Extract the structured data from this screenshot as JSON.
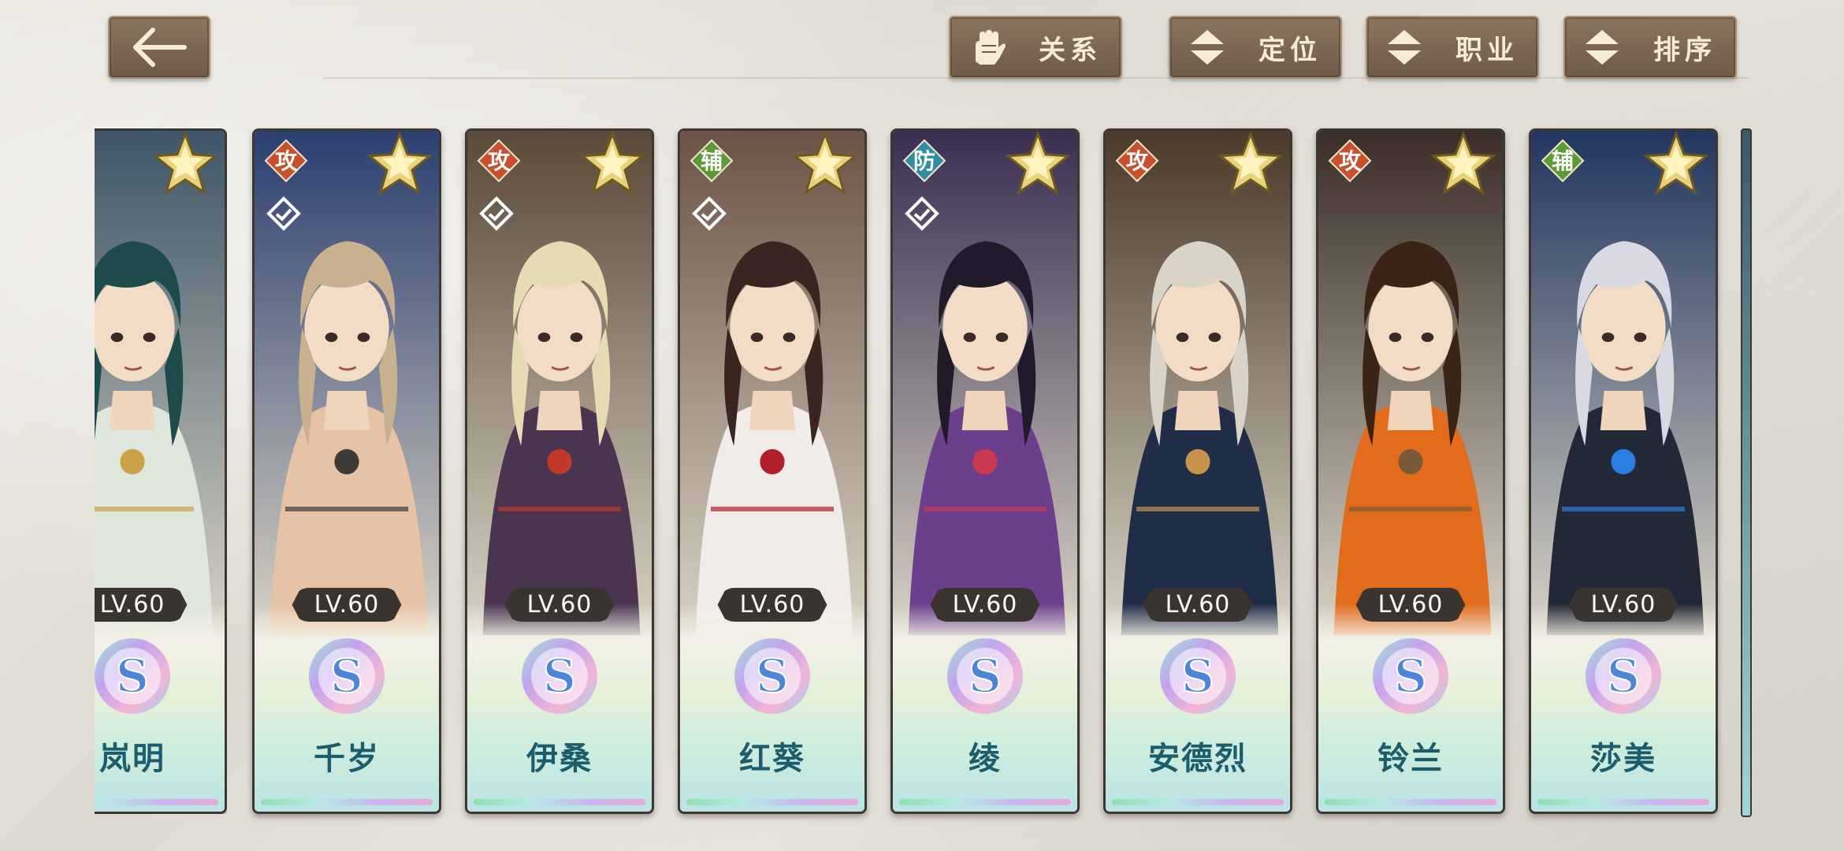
{
  "header": {
    "back_icon": "back-arrow-icon",
    "filters": [
      {
        "label": "关系",
        "icon": "gauntlet-icon"
      },
      {
        "label": "定位",
        "icon": "up-down-arrow-icon"
      },
      {
        "label": "职业",
        "icon": "up-down-arrow-icon"
      },
      {
        "label": "排序",
        "icon": "up-down-arrow-icon"
      }
    ]
  },
  "characters": [
    {
      "name": "岚明",
      "level": "LV.60",
      "role": "",
      "rank": "S",
      "palette": {
        "bg": "#3e5668",
        "hair": "#1d4a4a",
        "cloth": "#dfe6dc",
        "accent": "#c9a24a"
      }
    },
    {
      "name": "千岁",
      "level": "LV.60",
      "role": "攻",
      "role_color": "#c8502c",
      "rank": "S",
      "palette": {
        "bg": "#2b3f70",
        "hair": "#c9b08e",
        "cloth": "#e7c2a4",
        "accent": "#3b3b3b"
      }
    },
    {
      "name": "伊桑",
      "level": "LV.60",
      "role": "攻",
      "role_color": "#c8502c",
      "rank": "S",
      "palette": {
        "bg": "#5a4a3a",
        "hair": "#e6dcb4",
        "cloth": "#4a3550",
        "accent": "#c0392b"
      }
    },
    {
      "name": "红葵",
      "level": "LV.60",
      "role": "辅",
      "role_color": "#5c9a34",
      "rank": "S",
      "palette": {
        "bg": "#6b5447",
        "hair": "#3a2520",
        "cloth": "#f1ece8",
        "accent": "#b21f2a"
      }
    },
    {
      "name": "绫",
      "level": "LV.60",
      "role": "防",
      "role_color": "#2f8fa0",
      "rank": "S",
      "palette": {
        "bg": "#3a2f52",
        "hair": "#201a2a",
        "cloth": "#6b3f8c",
        "accent": "#c93a4e"
      }
    },
    {
      "name": "安德烈",
      "level": "LV.60",
      "role": "攻",
      "role_color": "#c8502c",
      "rank": "S",
      "palette": {
        "bg": "#4a3a2a",
        "hair": "#d9d3c8",
        "cloth": "#1f2d48",
        "accent": "#c6944a"
      }
    },
    {
      "name": "铃兰",
      "level": "LV.60",
      "role": "攻",
      "role_color": "#c8502c",
      "rank": "S",
      "palette": {
        "bg": "#3a2e26",
        "hair": "#3a2418",
        "cloth": "#e36b1c",
        "accent": "#7a5a3a"
      }
    },
    {
      "name": "莎美",
      "level": "LV.60",
      "role": "辅",
      "role_color": "#5c9a34",
      "rank": "S",
      "palette": {
        "bg": "#223660",
        "hair": "#d8d9e2",
        "cloth": "#232836",
        "accent": "#2b7fe0"
      }
    }
  ]
}
